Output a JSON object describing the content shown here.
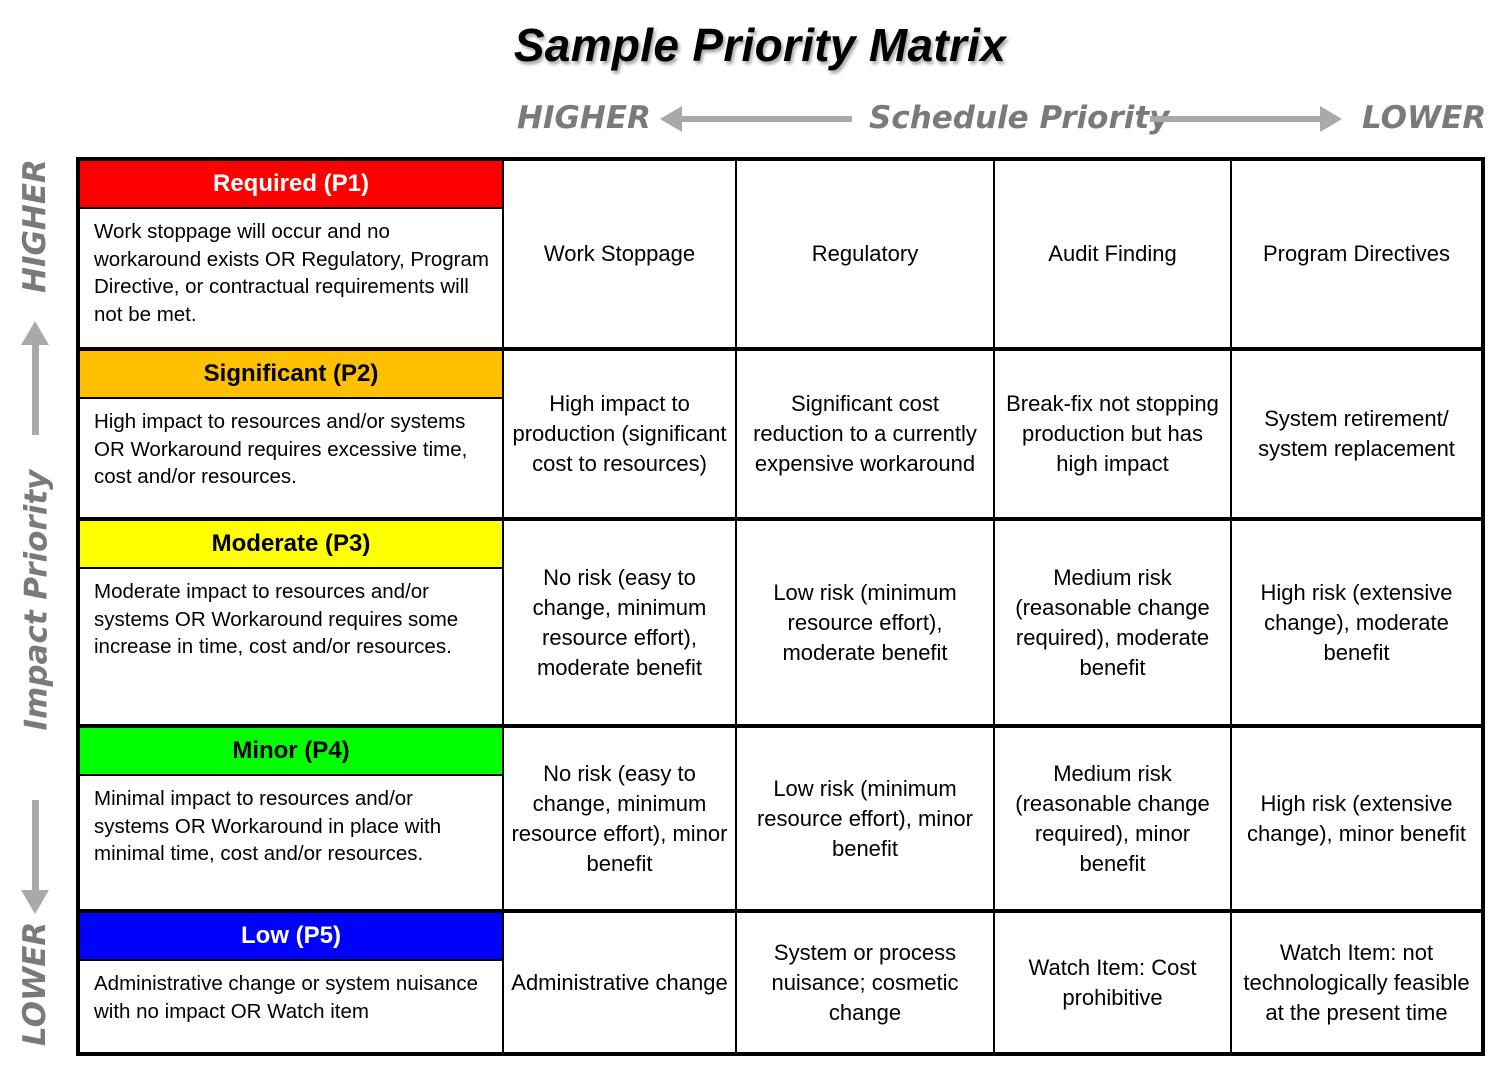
{
  "title": "Sample Priority Matrix",
  "schedule_axis": {
    "label": "Schedule Priority",
    "left_end": "HIGHER",
    "right_end": "LOWER",
    "left_arrow_icon": "arrow-left-icon",
    "right_arrow_icon": "arrow-right-icon"
  },
  "impact_axis": {
    "label": "Impact Priority",
    "top_end": "HIGHER",
    "bottom_end": "LOWER",
    "up_arrow_icon": "arrow-up-icon",
    "down_arrow_icon": "arrow-down-icon"
  },
  "colors": {
    "axis_gray": "#7a7a7a",
    "arrow_gray": "#a9a9a9",
    "p1": "#ff0000",
    "p2": "#ffc000",
    "p3": "#ffff00",
    "p4": "#00ff00",
    "p5": "#0000ff"
  },
  "levels": [
    {
      "name": "Required (P1)",
      "color": "#ff0000",
      "text_color": "#ffffff",
      "description": "Work stoppage will occur and no workaround exists OR Regulatory, Program Directive, or contractual requirements will not be met.",
      "cells": [
        "Work Stoppage",
        "Regulatory",
        "Audit Finding",
        "Program Directives"
      ]
    },
    {
      "name": "Significant (P2)",
      "color": "#ffc000",
      "text_color": "#000000",
      "description": "High impact to resources and/or systems OR Workaround requires excessive time, cost and/or resources.",
      "cells": [
        "High impact to production (significant cost to resources)",
        "Significant cost reduction to a currently expensive workaround",
        "Break-fix not stopping production but has high impact",
        "System retirement/ system replacement"
      ]
    },
    {
      "name": "Moderate (P3)",
      "color": "#ffff00",
      "text_color": "#000000",
      "description": "Moderate impact to resources and/or systems OR Workaround requires some increase in time, cost and/or resources.",
      "cells": [
        "No risk (easy to change, minimum resource effort), moderate benefit",
        "Low risk (minimum resource effort), moderate benefit",
        "Medium risk (reasonable change required), moderate benefit",
        "High risk (extensive change), moderate benefit"
      ]
    },
    {
      "name": "Minor (P4)",
      "color": "#00ff00",
      "text_color": "#000000",
      "description": "Minimal impact to resources and/or systems OR Workaround in place with minimal time, cost and/or resources.",
      "cells": [
        "No risk (easy to change, minimum resource effort), minor benefit",
        "Low risk (minimum resource effort), minor benefit",
        "Medium risk (reasonable change required), minor benefit",
        "High risk (extensive change), minor benefit"
      ]
    },
    {
      "name": "Low (P5)",
      "color": "#0000ff",
      "text_color": "#ffffff",
      "description": "Administrative change or system nuisance with no impact OR Watch item",
      "cells": [
        "Administrative change",
        "System or process nuisance; cosmetic change",
        "Watch Item: Cost prohibitive",
        "Watch Item: not technologically feasible at the present time"
      ]
    }
  ]
}
